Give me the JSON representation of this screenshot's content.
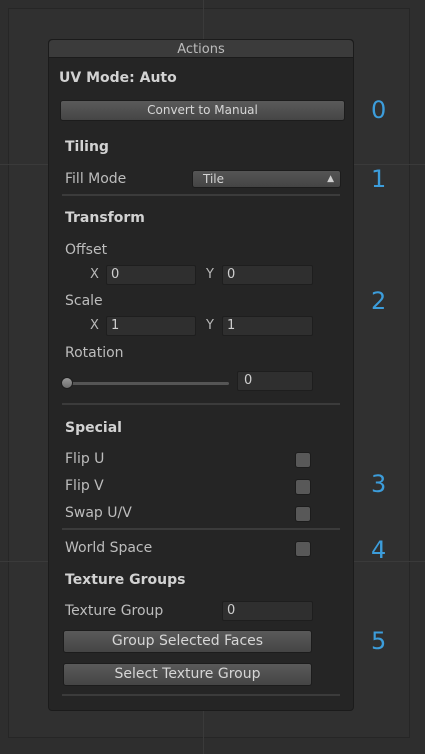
{
  "panel": {
    "title": "Actions"
  },
  "uv_mode": {
    "label": "UV Mode: Auto",
    "convert_button": "Convert to Manual"
  },
  "tiling": {
    "heading": "Tiling",
    "fill_mode_label": "Fill Mode",
    "fill_mode_value": "Tile"
  },
  "transform": {
    "heading": "Transform",
    "offset_label": "Offset",
    "offset_x_label": "X",
    "offset_x": "0",
    "offset_y_label": "Y",
    "offset_y": "0",
    "scale_label": "Scale",
    "scale_x_label": "X",
    "scale_x": "1",
    "scale_y_label": "Y",
    "scale_y": "1",
    "rotation_label": "Rotation",
    "rotation_value": "0",
    "rotation_fraction": 0
  },
  "special": {
    "heading": "Special",
    "flip_u": "Flip U",
    "flip_v": "Flip V",
    "swap_uv": "Swap U/V",
    "world_space": "World Space"
  },
  "texture_groups": {
    "heading": "Texture Groups",
    "group_label": "Texture Group",
    "group_value": "0",
    "group_selected_button": "Group Selected Faces",
    "select_group_button": "Select Texture Group"
  },
  "annotations": [
    "0",
    "1",
    "2",
    "3",
    "4",
    "5"
  ],
  "colors": {
    "annotation": "#3c9ddb",
    "panel_bg": "#252525",
    "viewport_bg": "#303030"
  }
}
